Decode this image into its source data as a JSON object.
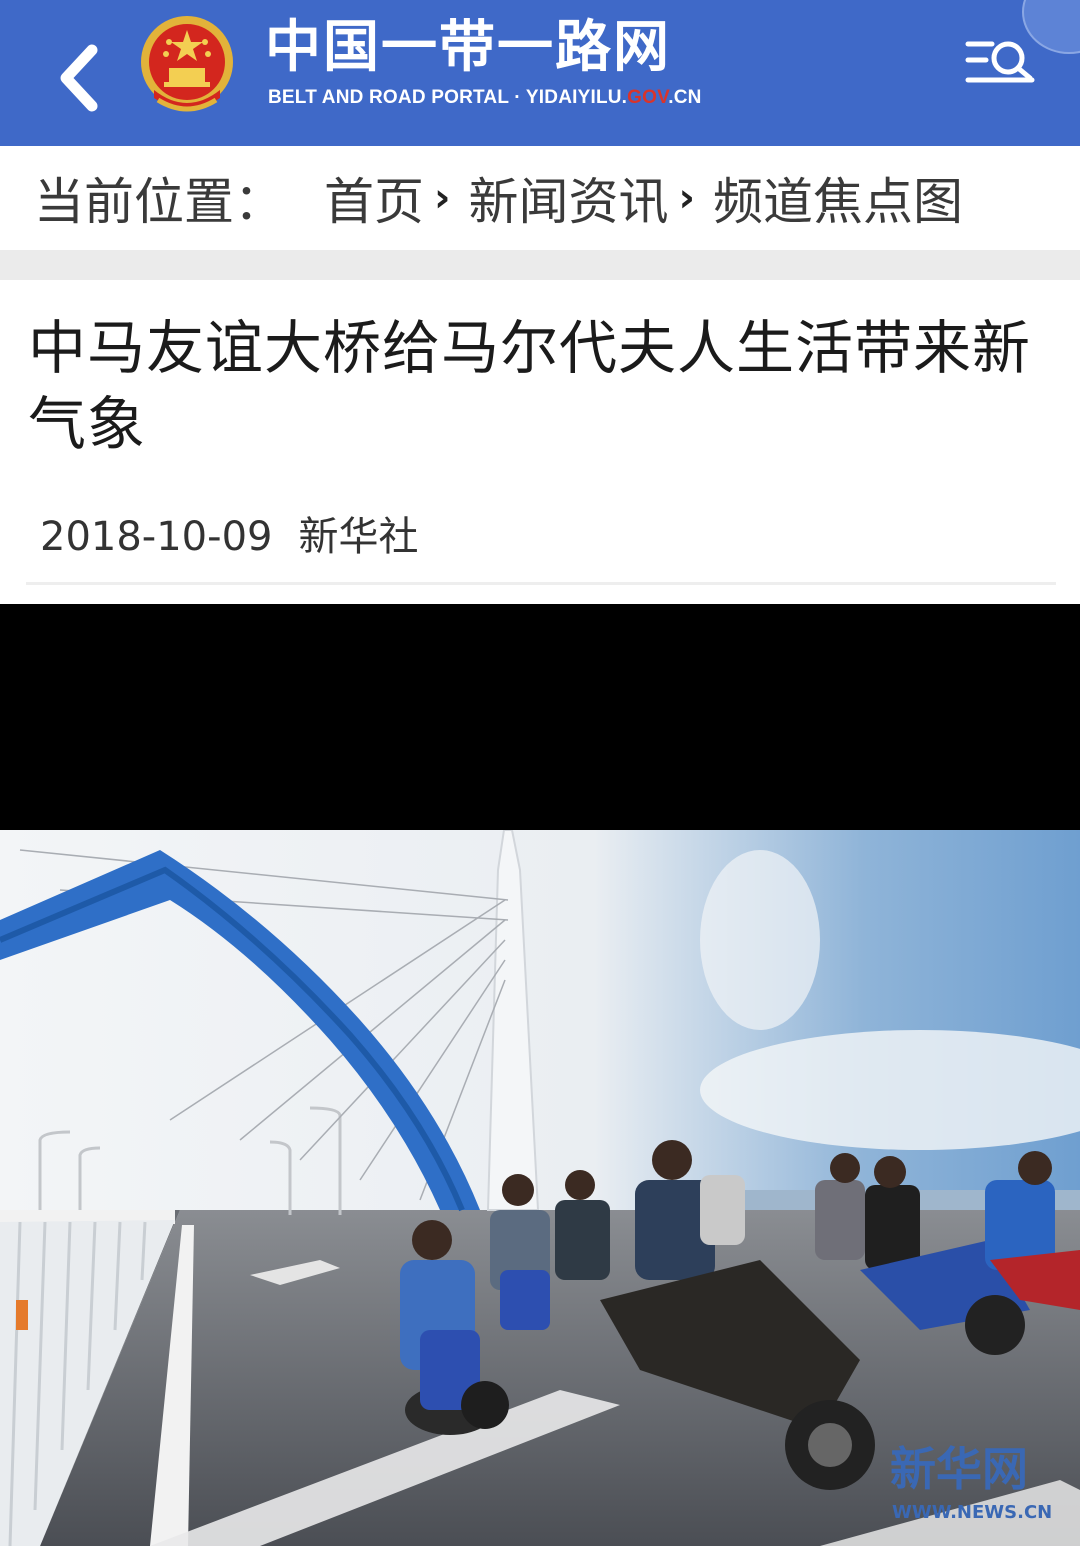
{
  "header": {
    "back_icon": "chevron-left-icon",
    "emblem_icon": "national-emblem-icon",
    "title": "中国一带一路网",
    "subtitle_prefix": "BELT AND ROAD PORTAL · YIDAIYILU.",
    "subtitle_gov": "GOV",
    "subtitle_suffix": ".CN",
    "menu_icon": "menu-search-icon",
    "bg_color": "#3f69c8"
  },
  "breadcrumb": {
    "label": "当前位置：",
    "items": [
      "首页",
      "新闻资讯",
      "频道焦点图"
    ],
    "separator": "›"
  },
  "article": {
    "title": "中马友谊大桥给马尔代夫人生活带来新气象",
    "date": "2018-10-09",
    "source": "新华社"
  },
  "photo": {
    "description_icon": "bridge-photo",
    "watermark_title": "新华网",
    "watermark_url": "WWW.NEWS.CN"
  }
}
